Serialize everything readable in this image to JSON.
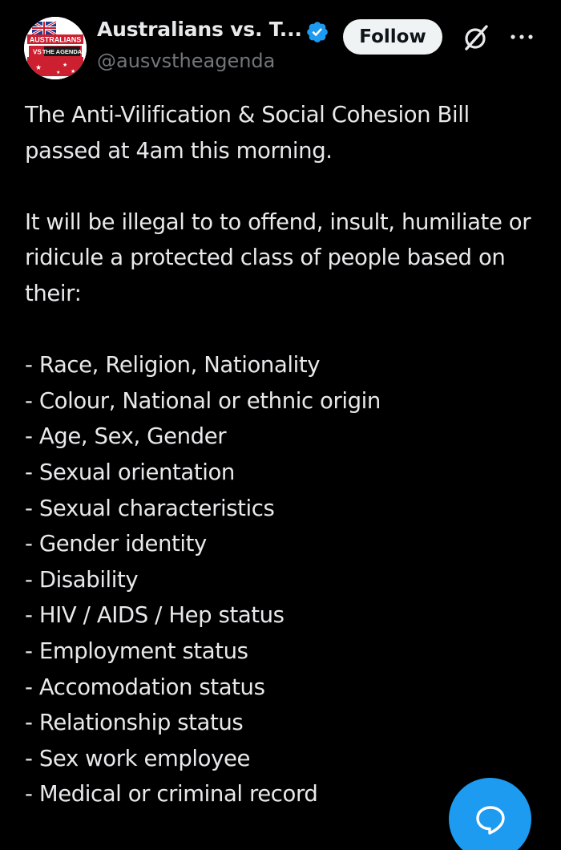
{
  "header": {
    "display_name": "Australians vs. T...",
    "handle": "@ausvstheagenda",
    "follow_label": "Follow",
    "avatar_text_top": "AUSTRALIANS",
    "avatar_text_mid": "VS",
    "avatar_text_bottom": "THE AGENDA"
  },
  "tweet": {
    "paragraph_1": "The Anti-Vilification & Social Cohesion Bill passed at 4am this morning.",
    "paragraph_2": "It will be illegal to to offend, insult, humiliate or ridicule a protected class of people based on their:",
    "list": [
      "- Race, Religion, Nationality",
      "- Colour, National or ethnic origin",
      "- Age, Sex, Gender",
      "- Sexual orientation",
      "- Sexual characteristics",
      "- Gender identity",
      "- Disability",
      "- HIV / AIDS / Hep status",
      "- Employment status",
      "- Accomodation status",
      "- Relationship status",
      "- Sex work employee",
      "- Medical or criminal record"
    ]
  },
  "colors": {
    "background": "#000000",
    "text": "#e7e9ea",
    "secondary_text": "#71767b",
    "accent": "#1d9bf0",
    "follow_bg": "#eff3f4"
  },
  "icons": {
    "verified": "verified-badge-icon",
    "grok": "grok-icon",
    "more": "more-horizontal-icon",
    "fab": "reply-chat-icon"
  }
}
